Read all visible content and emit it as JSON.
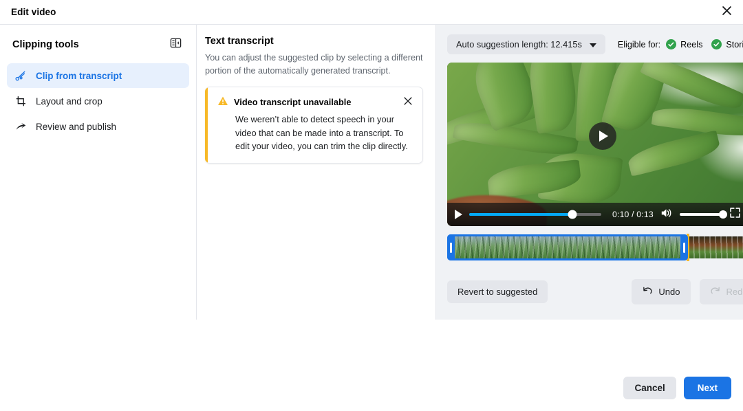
{
  "header": {
    "title": "Edit video",
    "close_icon": "close-icon"
  },
  "sidebar": {
    "title": "Clipping tools",
    "panel_toggle_icon": "collapse-panel-icon",
    "items": [
      {
        "label": "Clip from transcript",
        "icon": "scissors-icon",
        "active": true
      },
      {
        "label": "Layout and crop",
        "icon": "crop-icon",
        "active": false
      },
      {
        "label": "Review and publish",
        "icon": "share-arrow-icon",
        "active": false
      }
    ]
  },
  "transcript": {
    "title": "Text transcript",
    "description": "You can adjust the suggested clip by selecting a different portion of the automatically generated transcript.",
    "callout": {
      "icon": "warning-triangle-icon",
      "title": "Video transcript unavailable",
      "body": "We weren’t able to detect speech in your video that can be made into a transcript. To edit your video, you can trim the clip directly.",
      "close_icon": "close-icon",
      "accent_color": "#f7b928"
    }
  },
  "editor": {
    "suggestion": {
      "label": "Auto suggestion length: 12.415s",
      "chevron_icon": "chevron-down-icon"
    },
    "eligibility": {
      "label": "Eligible for:",
      "badge_color": "#31a24c",
      "items": [
        {
          "name": "Reels",
          "icon": "check-circle-icon"
        },
        {
          "name": "Stories",
          "icon": "check-circle-icon"
        }
      ]
    },
    "player": {
      "play_overlay_icon": "play-circle-icon",
      "play_icon": "play-icon",
      "current_time": "0:10",
      "duration": "0:13",
      "time_display": "0:10 / 0:13",
      "progress_percent": 78,
      "progress_color": "#04a9f4",
      "volume_icon": "volume-icon",
      "volume_percent": 100,
      "fullscreen_icon": "fullscreen-icon",
      "scene_description": "Close-up of a green aloe vera plant with brown soil"
    },
    "timeline": {
      "selection_start_percent": 0,
      "selection_end_percent": 77.5,
      "playhead_percent": 77.5,
      "selection_color": "#1b74e4",
      "playhead_color": "#f7b928",
      "left_handle_name": "trim-handle-left",
      "right_handle_name": "trim-handle-right"
    },
    "actions": {
      "revert_label": "Revert to suggested",
      "undo_label": "Undo",
      "undo_icon": "undo-arrow-icon",
      "redo_label": "Redo",
      "redo_icon": "redo-arrow-icon",
      "redo_disabled": true
    }
  },
  "footer": {
    "cancel_label": "Cancel",
    "next_label": "Next",
    "next_color": "#1b74e4"
  }
}
